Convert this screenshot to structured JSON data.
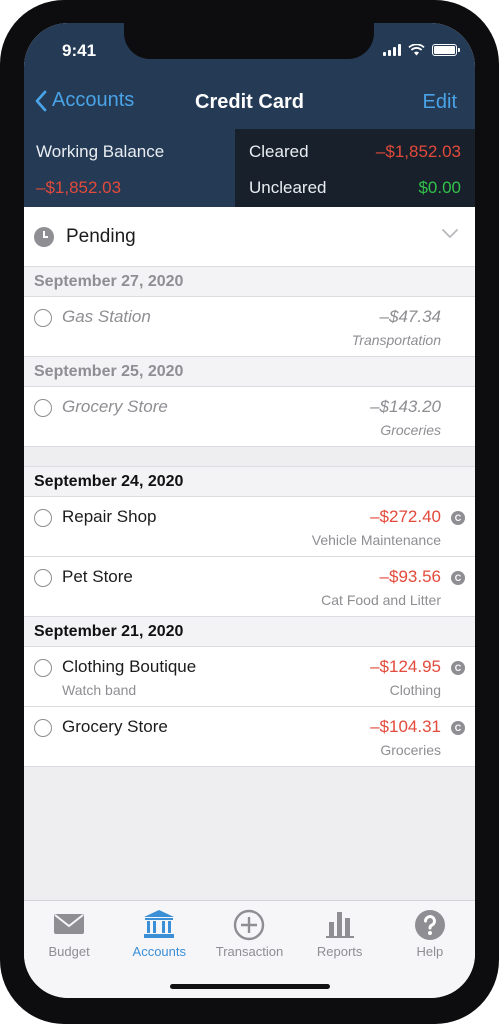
{
  "status_bar": {
    "time": "9:41"
  },
  "nav": {
    "back_label": "Accounts",
    "title": "Credit Card",
    "edit_label": "Edit"
  },
  "balances": {
    "working_label": "Working Balance",
    "working_value": "–$1,852.03",
    "cleared_label": "Cleared",
    "cleared_value": "–$1,852.03",
    "uncleared_label": "Uncleared",
    "uncleared_value": "$0.00"
  },
  "pending": {
    "label": "Pending",
    "sections": [
      {
        "date": "September 27, 2020",
        "items": [
          {
            "payee": "Gas Station",
            "memo": "",
            "amount": "–$47.34",
            "category": "Transportation"
          }
        ]
      },
      {
        "date": "September 25, 2020",
        "items": [
          {
            "payee": "Grocery Store",
            "memo": "",
            "amount": "–$143.20",
            "category": "Groceries"
          }
        ]
      }
    ]
  },
  "posted": {
    "sections": [
      {
        "date": "September 24, 2020",
        "items": [
          {
            "payee": "Repair Shop",
            "memo": "",
            "amount": "–$272.40",
            "category": "Vehicle Maintenance",
            "cleared_mark": "C"
          },
          {
            "payee": "Pet Store",
            "memo": "",
            "amount": "–$93.56",
            "category": "Cat Food and Litter",
            "cleared_mark": "C"
          }
        ]
      },
      {
        "date": "September 21, 2020",
        "items": [
          {
            "payee": "Clothing Boutique",
            "memo": "Watch band",
            "amount": "–$124.95",
            "category": "Clothing",
            "cleared_mark": "C"
          },
          {
            "payee": "Grocery Store",
            "memo": "",
            "amount": "–$104.31",
            "category": "Groceries",
            "cleared_mark": "C"
          }
        ]
      }
    ]
  },
  "tab_bar": {
    "tabs": [
      {
        "label": "Budget",
        "icon": "envelope-icon",
        "active": false
      },
      {
        "label": "Accounts",
        "icon": "bank-icon",
        "active": true
      },
      {
        "label": "Transaction",
        "icon": "plus-circle-icon",
        "active": false
      },
      {
        "label": "Reports",
        "icon": "bar-chart-icon",
        "active": false
      },
      {
        "label": "Help",
        "icon": "question-icon",
        "active": false
      }
    ]
  },
  "colors": {
    "header_bg": "#243a55",
    "balance_dark_bg": "#17202b",
    "negative": "#e24a3b",
    "positive": "#33c24a",
    "accent": "#4aa3e6"
  }
}
